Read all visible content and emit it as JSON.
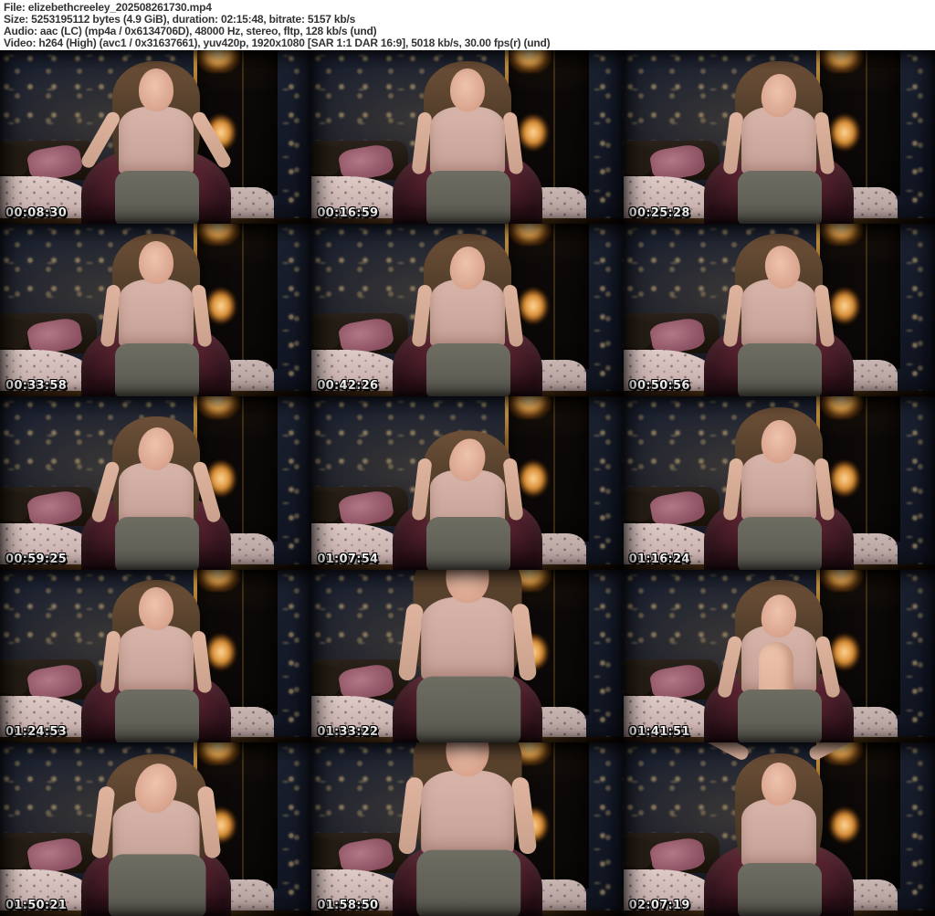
{
  "header": {
    "lines": [
      "File: elizebethcreeley_202508261730.mp4",
      "Size: 5253195112 bytes (4.9 GiB), duration: 02:15:48, bitrate: 5157 kb/s",
      "Audio: aac (LC) (mp4a / 0x6134706D), 48000 Hz, stereo, fltp, 128 kb/s (und)",
      "Video: h264 (High) (avc1 / 0x31637661), yuv420p, 1920x1080 [SAR 1:1 DAR 16:9], 5018 kb/s, 30.00 fps(r) (und)"
    ]
  },
  "grid": {
    "columns": 3,
    "rows": 5
  },
  "thumbnails": [
    {
      "timestamp": "00:08:30",
      "pose": "hands-on-hips"
    },
    {
      "timestamp": "00:16:59",
      "pose": "upright"
    },
    {
      "timestamp": "00:25:28",
      "pose": "head-down"
    },
    {
      "timestamp": "00:33:58",
      "pose": "upright"
    },
    {
      "timestamp": "00:42:26",
      "pose": "head-down"
    },
    {
      "timestamp": "00:50:56",
      "pose": "head-tilt"
    },
    {
      "timestamp": "00:59:25",
      "pose": "lean-forward"
    },
    {
      "timestamp": "01:07:54",
      "pose": "lean-deep"
    },
    {
      "timestamp": "01:16:24",
      "pose": "head-down"
    },
    {
      "timestamp": "01:24:53",
      "pose": "upright"
    },
    {
      "timestamp": "01:33:22",
      "pose": "close-up"
    },
    {
      "timestamp": "01:41:51",
      "pose": "knee-up"
    },
    {
      "timestamp": "01:50:21",
      "pose": "lean-deep-close"
    },
    {
      "timestamp": "01:58:50",
      "pose": "close-up"
    },
    {
      "timestamp": "02:07:19",
      "pose": "arms-up"
    }
  ],
  "colors": {
    "page_background": "#ffffff",
    "header_text": "#333333",
    "timestamp_text": "#ffffff",
    "wallpaper_navy": "#1b2130",
    "floral_beige": "#9a8766",
    "lamp_gold": "#f0c070",
    "mirror_dark": "#0c0a08",
    "bed_linen": "#d7c1bd",
    "pillow_mauve": "#a66a78",
    "chair_burgundy": "#54222e",
    "hair_brown": "#55402c",
    "skin_tone": "#e3b7a1",
    "top_pink": "#cfa9a0",
    "skirt_gray": "#62615a"
  }
}
